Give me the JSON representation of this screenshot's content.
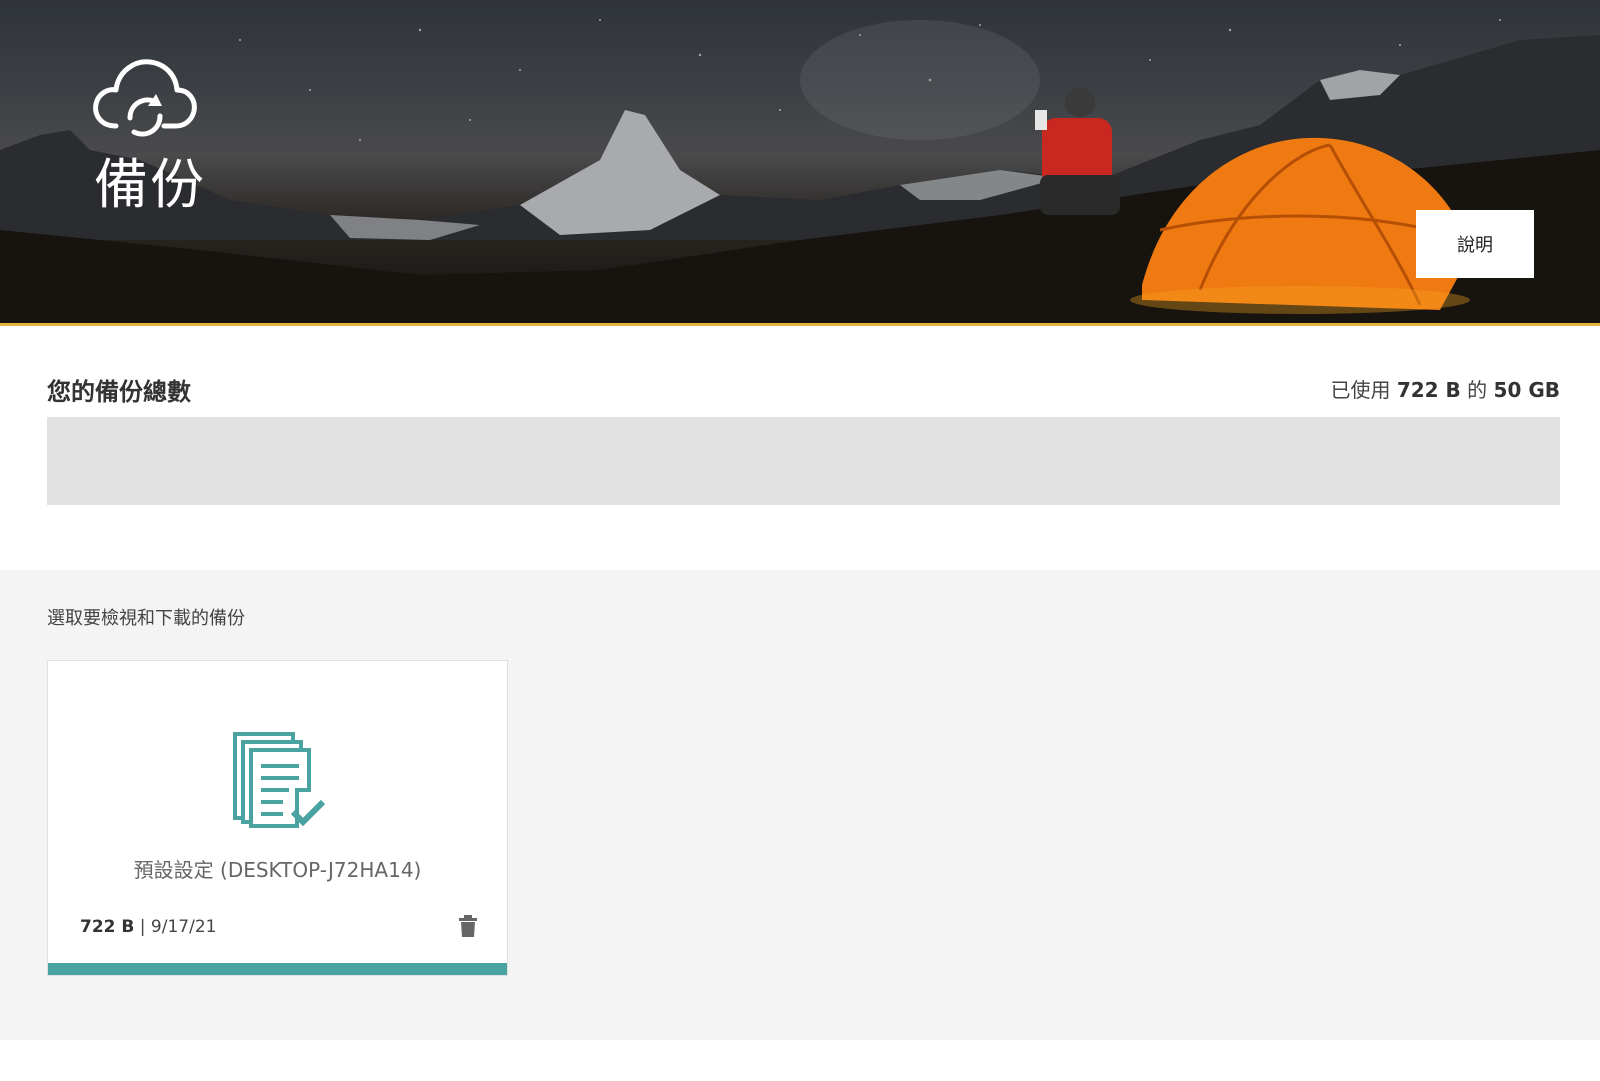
{
  "hero": {
    "title": "備份",
    "help_label": "說明",
    "icon": "cloud-sync-icon"
  },
  "usage": {
    "title": "您的備份總數",
    "prefix": "已使用",
    "used": "722 B",
    "of": "的",
    "quota": "50 GB",
    "fraction_used": 1e-08
  },
  "backups": {
    "heading": "選取要檢視和下載的備份",
    "items": [
      {
        "name": "預設設定 (DESKTOP-J72HA14)",
        "size": "722 B",
        "separator": "|",
        "date": "9/17/21",
        "icon": "document-check-icon",
        "delete_icon": "trash-icon"
      }
    ]
  },
  "colors": {
    "accent": "#4aa3a0",
    "hero_border": "#e2b53c",
    "usage_track": "#e1e1e1",
    "list_background": "#f4f4f4"
  }
}
